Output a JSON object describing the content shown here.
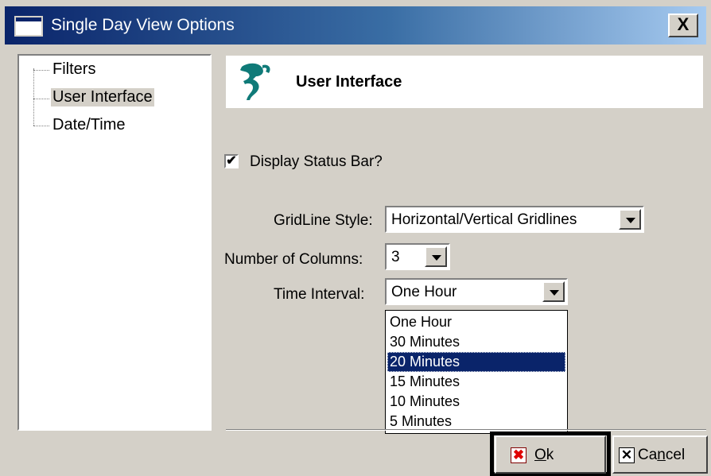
{
  "window": {
    "title": "Single Day View Options",
    "close_label": "X"
  },
  "tree": {
    "items": [
      {
        "label": "Filters"
      },
      {
        "label": "User Interface"
      },
      {
        "label": "Date/Time"
      }
    ]
  },
  "header": {
    "title": "User Interface"
  },
  "status_bar": {
    "label": "Display Status Bar?",
    "checked": true,
    "check_mark": "✔"
  },
  "gridline": {
    "label": "GridLine Style:",
    "value": "Horizontal/Vertical Gridlines"
  },
  "columns": {
    "label": "Number of Columns:",
    "value": "3"
  },
  "interval": {
    "label": "Time Interval:",
    "value": "One Hour",
    "options": [
      "One Hour",
      "30 Minutes",
      "20 Minutes",
      "15 Minutes",
      "10 Minutes",
      "5 Minutes"
    ],
    "highlighted": "20 Minutes"
  },
  "buttons": {
    "ok": {
      "accel": "O",
      "rest": "k",
      "icon": "✖"
    },
    "cancel": {
      "pre": "Ca",
      "accel": "n",
      "rest": "cel",
      "icon": "✕"
    }
  },
  "colors": {
    "title_start": "#0a246a",
    "title_end": "#a6caf0",
    "ok_icon": "#e00000",
    "face": "#d4d0c8"
  }
}
